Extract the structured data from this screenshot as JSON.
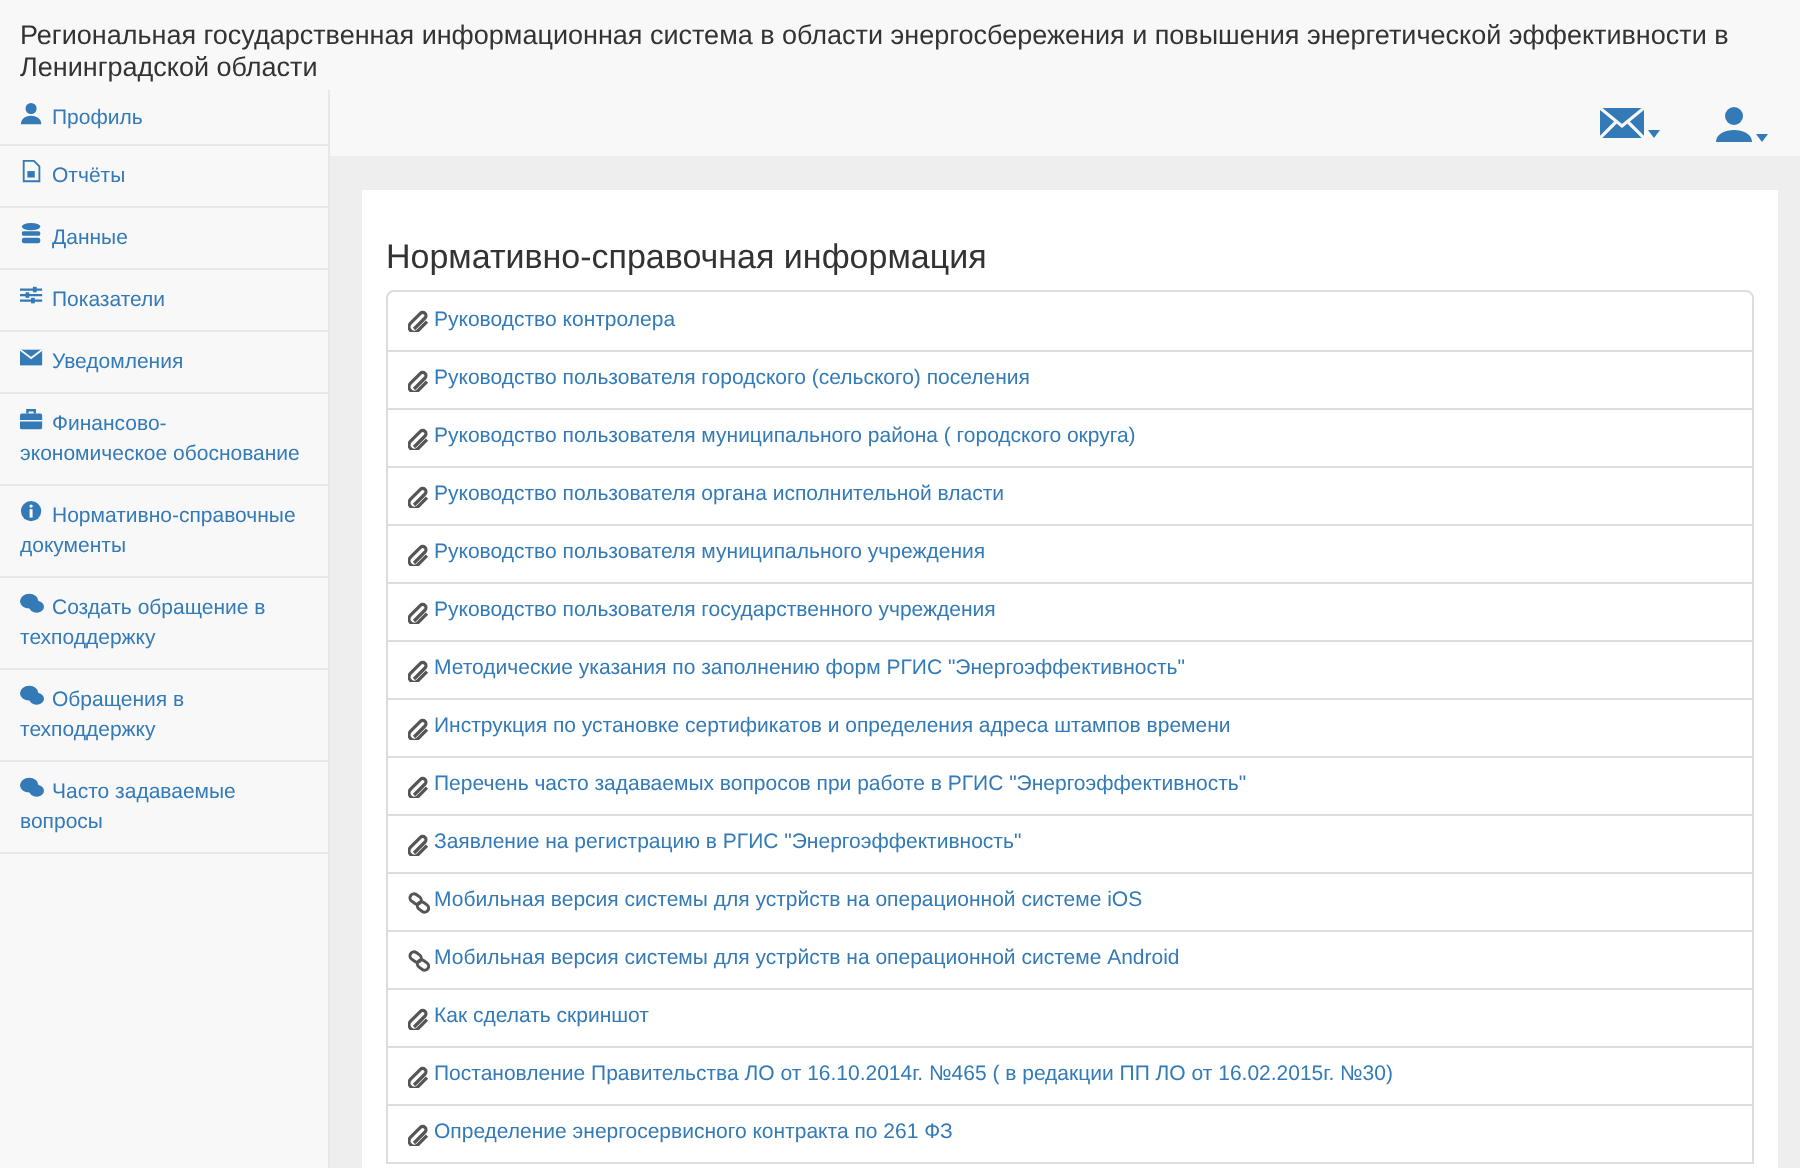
{
  "header": {
    "title": "Региональная государственная информационная система в области энергосбережения и повышения энергетической эффективности в Ленинградской области"
  },
  "sidebar": {
    "items": [
      {
        "label": "Профиль",
        "kind": "user"
      },
      {
        "label": "Отчёты",
        "kind": "file"
      },
      {
        "label": "Данные",
        "kind": "database"
      },
      {
        "label": "Показатели",
        "kind": "sliders"
      },
      {
        "label": "Уведомления",
        "kind": "envelope"
      },
      {
        "label": "Финансово-экономическое обоснование",
        "kind": "briefcase"
      },
      {
        "label": "Нормативно-справочные документы",
        "kind": "info"
      },
      {
        "label": "Создать обращение в техподдержку",
        "kind": "comments"
      },
      {
        "label": "Обращения в техподдержку",
        "kind": "comments"
      },
      {
        "label": "Часто задаваемые вопросы",
        "kind": "comments"
      }
    ]
  },
  "panel": {
    "title": "Нормативно-справочная информация",
    "items": [
      {
        "label": "Руководство контролера",
        "kind": "file"
      },
      {
        "label": "Руководство пользователя городского (сельского) поселения",
        "kind": "file"
      },
      {
        "label": "Руководство пользователя муниципального района ( городского округа)",
        "kind": "file"
      },
      {
        "label": "Руководство пользователя органа исполнительной власти",
        "kind": "file"
      },
      {
        "label": "Руководство пользователя муниципального учреждения",
        "kind": "file"
      },
      {
        "label": "Руководство пользователя государственного учреждения",
        "kind": "file"
      },
      {
        "label": "Методические указания по заполнению форм РГИС \"Энергоэффективность\"",
        "kind": "file"
      },
      {
        "label": "Инструкция по установке сертификатов и определения адреса штампов времени",
        "kind": "file"
      },
      {
        "label": "Перечень часто задаваемых вопросов при работе в РГИС \"Энергоэффективность\"",
        "kind": "file"
      },
      {
        "label": "Заявление на регистрацию в РГИС \"Энергоэффективность\"",
        "kind": "file"
      },
      {
        "label": "Мобильная версия системы для устрйств на операционной системе iOS",
        "kind": "link"
      },
      {
        "label": "Мобильная версия системы для устрйств на операционной системе Android",
        "kind": "link"
      },
      {
        "label": "Как сделать скриншот",
        "kind": "file"
      },
      {
        "label": "Постановление Правительства ЛО от 16.10.2014г. №465 ( в редакции ПП ЛО от 16.02.2015г. №30)",
        "kind": "file"
      },
      {
        "label": "Определение энергосервисного контракта по 261 ФЗ",
        "kind": "file"
      }
    ]
  }
}
